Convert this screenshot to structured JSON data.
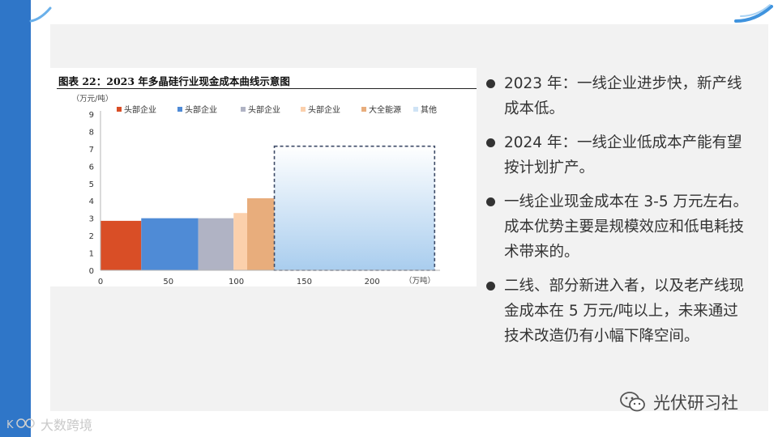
{
  "slide": {
    "bullets": [
      "2023 年：一线企业进步快，新产线成本低。",
      "2024 年：一线企业低成本产能有望按计划扩产。",
      "一线企业现金成本在 3-5 万元左右。成本优势主要是规模效应和低电耗技术带来的。",
      "二线、部分新进入者，以及老产线现金成本在 5 万元/吨以上，未来通过技术改造仍有小幅下降空间。"
    ],
    "wechat_account": "光伏研习社",
    "watermark": "大数跨境"
  },
  "colors": {
    "accent_blue": "#2f76c8",
    "panel_bg": "#f2f2f2"
  },
  "chart_data": {
    "type": "bar",
    "title": "图表 22：2023 年多晶硅行业现金成本曲线示意图",
    "ylabel": "（万元/吨）",
    "xlabel": "（万吨）",
    "ylim": [
      0,
      9
    ],
    "xlim": [
      0,
      250
    ],
    "yticks": [
      0,
      1,
      2,
      3,
      4,
      5,
      6,
      7,
      8,
      9
    ],
    "xticks": [
      0,
      50,
      100,
      150,
      200
    ],
    "legend": [
      {
        "name": "头部企业",
        "color": "#d94e26"
      },
      {
        "name": "头部企业",
        "color": "#4f8bd6"
      },
      {
        "name": "头部企业",
        "color": "#b0b3c4"
      },
      {
        "name": "头部企业",
        "color": "#fbd0ac"
      },
      {
        "name": "大全能源",
        "color": "#e8ad7c"
      },
      {
        "name": "其他",
        "color": "#cfe3f5"
      }
    ],
    "legend_position": "top",
    "bars": [
      {
        "series": "头部企业",
        "x_start": 0,
        "x_end": 30,
        "value": 2.85,
        "color": "#d94e26"
      },
      {
        "series": "头部企业",
        "x_start": 30,
        "x_end": 72,
        "value": 3.0,
        "color": "#4f8bd6"
      },
      {
        "series": "头部企业",
        "x_start": 72,
        "x_end": 98,
        "value": 3.0,
        "color": "#b0b3c4"
      },
      {
        "series": "头部企业",
        "x_start": 98,
        "x_end": 108,
        "value": 3.3,
        "color": "#fbd0ac"
      },
      {
        "series": "大全能源",
        "x_start": 108,
        "x_end": 128,
        "value": 4.15,
        "color": "#e8ad7c"
      },
      {
        "series": "其他",
        "x_start": 128,
        "x_end": 246,
        "value": 7.15,
        "color": "#cfe3f5",
        "dashed": true
      }
    ]
  }
}
